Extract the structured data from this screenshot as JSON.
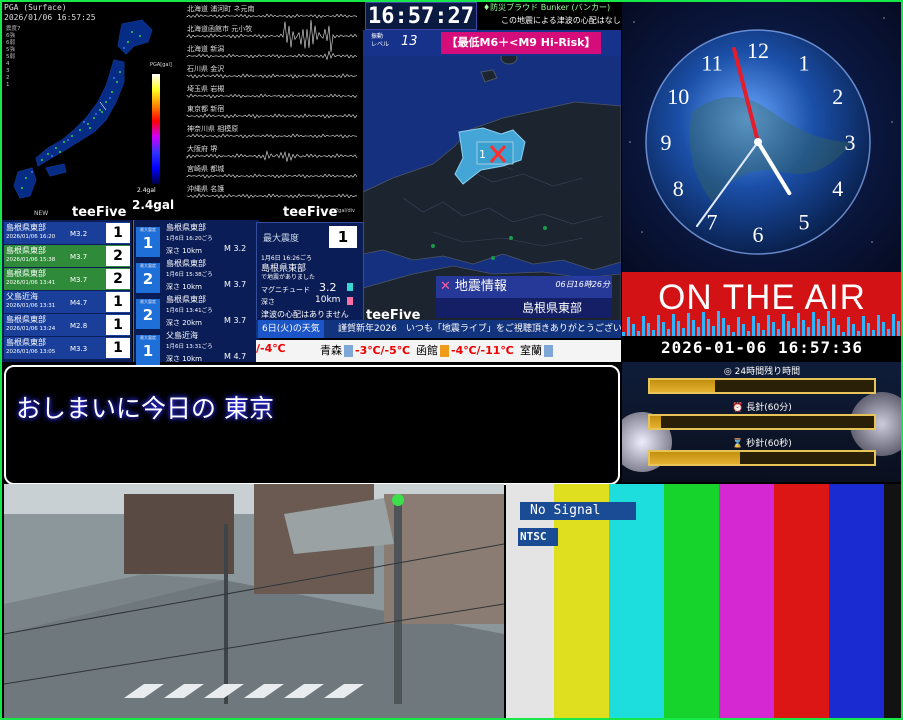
{
  "pga": {
    "header_line1": "PGA (Surface)",
    "header_line2": "2026/01/06 16:57:25",
    "scale_title": "PGA[gal]",
    "scale_ticks": [
      "2000",
      "1000",
      "500",
      "200",
      "100",
      "50",
      "20",
      "10",
      "5",
      "2",
      "1",
      "0.5",
      "0.2",
      "0.1"
    ],
    "gal_small": "2.4gal",
    "gal_big": "2.4gal",
    "brand": "teeFive",
    "new_tag": "NEW"
  },
  "waveform": {
    "stations": [
      "北海道 浦河町 ネ元南",
      "北海道函館市 元小牧",
      "北海道 新潟",
      "石川県 金沢",
      "埼玉県 岩槻",
      "東京都 新宿",
      "神奈川県 相模原",
      "大阪府 堺",
      "宮崎県 都城",
      "沖縄県 名護"
    ],
    "brand": "teeFive",
    "unit": "2gal/div"
  },
  "eq_list": [
    {
      "region": "島根県東部",
      "datetime": "2026/01/06 16:20",
      "mag": "M3.2",
      "intensity": "1",
      "color": "#2a6bd8"
    },
    {
      "region": "島根県東部",
      "datetime": "2026/01/06 15:38",
      "mag": "M3.7",
      "intensity": "2",
      "color": "#3aa843"
    },
    {
      "region": "島根県東部",
      "datetime": "2026/01/06 13:41",
      "mag": "M3.7",
      "intensity": "2",
      "color": "#3aa843"
    },
    {
      "region": "父島近海",
      "datetime": "2026/01/06 13:31",
      "mag": "M4.7",
      "intensity": "1",
      "color": "#2a6bd8"
    },
    {
      "region": "島根県東部",
      "datetime": "2026/01/06 13:24",
      "mag": "M2.8",
      "intensity": "1",
      "color": "#2a6bd8"
    },
    {
      "region": "島根県東部",
      "datetime": "2026/01/06 13:05",
      "mag": "M3.3",
      "intensity": "1",
      "color": "#2a6bd8"
    }
  ],
  "eq_detail": [
    {
      "badge_top": "最大震度",
      "badge": "1",
      "region": "島根県東部",
      "datetime": "1月6日 16:20ごろ",
      "depth": "深さ 10km",
      "mag": "M 3.2"
    },
    {
      "badge_top": "最大震度",
      "badge": "2",
      "region": "島根県東部",
      "datetime": "1月6日 15:38ごろ",
      "depth": "深さ 10km",
      "mag": "M 3.7"
    },
    {
      "badge_top": "最大震度",
      "badge": "2",
      "region": "島根県東部",
      "datetime": "1月6日 13:41ごろ",
      "depth": "深さ 20km",
      "mag": "M 3.7"
    },
    {
      "badge_top": "最大震度",
      "badge": "1",
      "region": "父島近海",
      "datetime": "1月6日 13:31ごろ",
      "depth": "深さ 10km",
      "mag": "M 4.7"
    }
  ],
  "max_intensity": {
    "title": "最大震度",
    "value": "1",
    "date": "1月6日 16:26ごろ",
    "region": "島根県東部",
    "note": "で地震がありました",
    "mag_label": "マグニチュード",
    "mag_value": "3.2",
    "depth_label": "深さ",
    "depth_value": "10km",
    "tsunami": "津波の心配はありません"
  },
  "map": {
    "clock": "16:57:27",
    "title_green": "♦防災ブラウド Bunker (バンカー)",
    "title_white": "この地震による津波の心配はなし",
    "level_label": "振動\nレベル",
    "level_value": "13",
    "risk": "【最低M6＋<M9 Hi-Risk】",
    "info_title": "地震情報",
    "info_when": "06日16時26分",
    "info_place": "島根県東部",
    "epicenter_label": "1",
    "brand": "teeFive"
  },
  "ticker": {
    "date": "6日(火)の天気",
    "message": "謹賀新年2026　いつも「地震ライブ」をご視聴頂きありがとうございます!"
  },
  "weather": [
    {
      "city": "",
      "temp": "/-4℃",
      "icon": "snow"
    },
    {
      "city": "青森",
      "temp": "-3℃/-5℃",
      "icon": "snow"
    },
    {
      "city": "函館",
      "temp": "-4℃/-11℃",
      "icon": "sun"
    },
    {
      "city": "室蘭",
      "temp": "",
      "icon": "snow"
    }
  ],
  "textbox": {
    "message": "おしまいに今日の 東京"
  },
  "clock": {
    "numerals": [
      "12",
      "1",
      "2",
      "3",
      "4",
      "5",
      "6",
      "7",
      "8",
      "9",
      "10",
      "11"
    ],
    "hour": 16,
    "minute": 57,
    "second": 36
  },
  "onair": {
    "label": "ON THE AIR",
    "datetime": "2026-01-06 16:57:36"
  },
  "timers": [
    {
      "label": "◎ 24時間残り時間",
      "progress": 0.29
    },
    {
      "label": "⏰ 長針(60分)",
      "progress": 0.05
    },
    {
      "label": "⌛ 秒針(60秒)",
      "progress": 0.4
    }
  ],
  "testpattern": {
    "no_signal": "No Signal",
    "ntsc": "NTSC",
    "colors": [
      "#e4e4e4",
      "#dfdf1f",
      "#1ddddd",
      "#17d42c",
      "#d628d2",
      "#dc1515",
      "#1a2bd2",
      "#121212"
    ]
  }
}
